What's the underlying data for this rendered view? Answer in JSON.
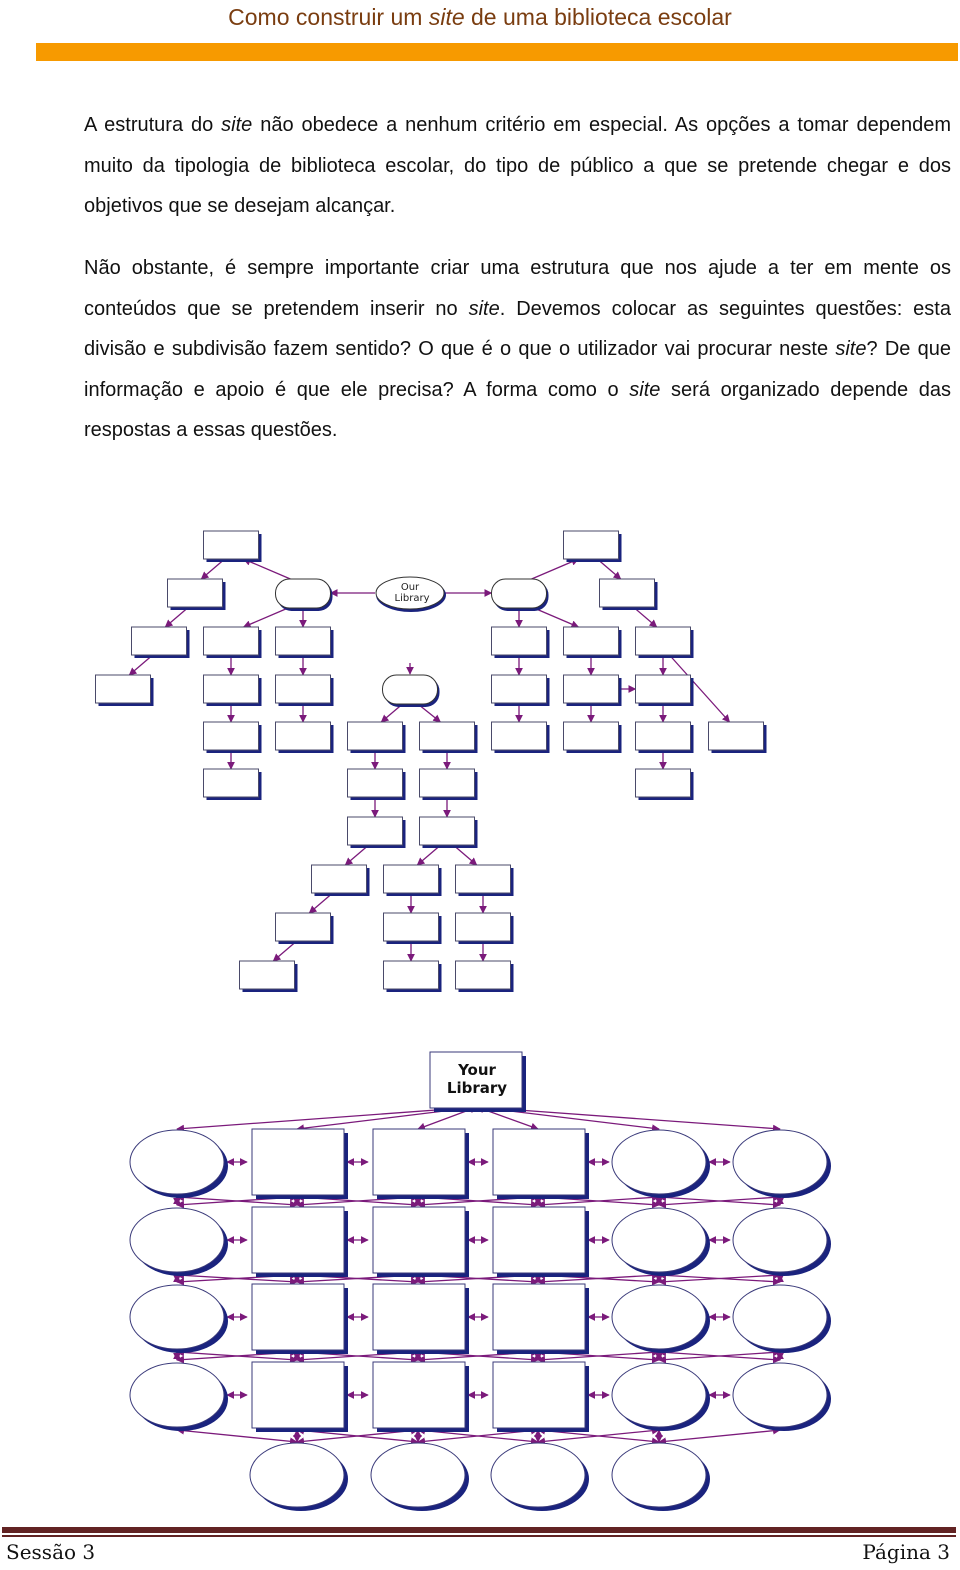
{
  "header": {
    "title_before": "Como construir um ",
    "title_italic": "site",
    "title_after": " de uma biblioteca escolar",
    "bar_color": "#f79a00",
    "title_color": "#7a3d10"
  },
  "body": {
    "paragraph1": {
      "part1": "A estrutura do ",
      "italic1": "site",
      "part2": " não obedece a nenhum critério em especial. As opções a tomar dependem muito da tipologia de biblioteca escolar, do tipo de público a que se pretende chegar e dos objetivos que se desejam alcançar."
    },
    "paragraph2": {
      "part1": "Não obstante, é sempre importante criar uma estrutura que nos ajude a ter em mente os conteúdos que se pretendem inserir no ",
      "italic1": "site",
      "part2": ". Devemos colocar as seguintes questões: esta divisão e subdivisão fazem sentido? O que é o que o utilizador vai procurar neste ",
      "italic2": "site",
      "part3": "? De que informação e apoio é que ele precisa? A forma como o ",
      "italic3": "site",
      "part4": " será organizado depende das respostas a essas questões."
    }
  },
  "figures": {
    "diagram1": {
      "type": "hierarchical-site-map",
      "root_label_line1": "Our",
      "root_label_line2": "Library",
      "node_color": "#1a237e",
      "edge_color": "#7b1a7b"
    },
    "diagram2": {
      "type": "web-site-map",
      "root_label_line1": "Your",
      "root_label_line2": "Library",
      "rows": [
        [
          "ellipse",
          "rect",
          "rect",
          "rect",
          "ellipse",
          "ellipse"
        ],
        [
          "ellipse",
          "rect",
          "rect",
          "rect",
          "ellipse",
          "ellipse"
        ],
        [
          "ellipse",
          "rect",
          "rect",
          "rect",
          "ellipse",
          "ellipse"
        ],
        [
          "ellipse",
          "rect",
          "rect",
          "rect",
          "ellipse",
          "ellipse"
        ],
        [
          "ellipse",
          "ellipse",
          "ellipse",
          "ellipse"
        ]
      ]
    }
  },
  "footer": {
    "left": "Sessão 3",
    "right": "Página 3",
    "rule_color": "#622323"
  }
}
